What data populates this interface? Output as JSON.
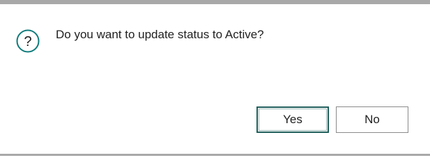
{
  "dialog": {
    "icon": "question-circle-icon",
    "message": "Do you want to update status to Active?",
    "accent_color": "#0f7b7b"
  },
  "buttons": {
    "yes_label": "Yes",
    "no_label": "No"
  }
}
